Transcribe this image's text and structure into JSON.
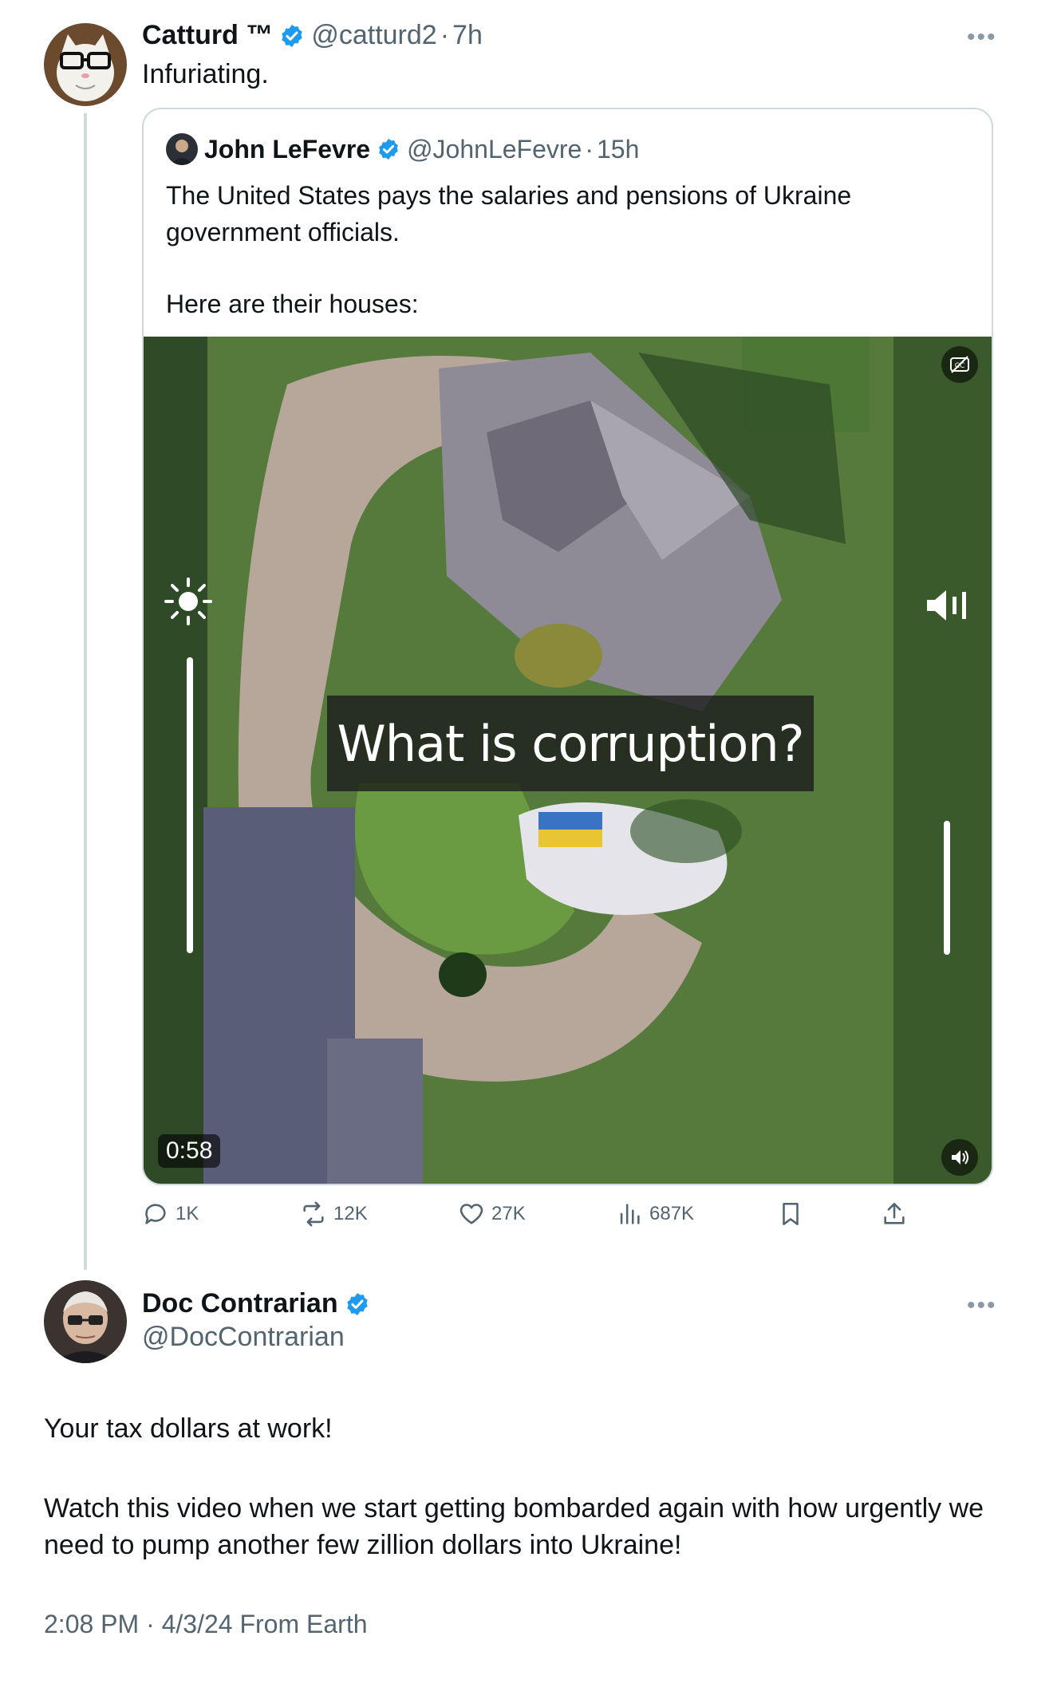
{
  "first_tweet": {
    "display_name": "Catturd ™",
    "handle": "@catturd2",
    "separator": "·",
    "time": "7h",
    "text": "Infuriating.",
    "avatar_icon": "cat-with-glasses-avatar"
  },
  "quoted_tweet": {
    "display_name": "John LeFevre",
    "handle": "@JohnLeFevre",
    "separator": "·",
    "time": "15h",
    "text_line1": "The United States pays the salaries and pensions of Ukraine government officials.",
    "text_line2": "Here are their houses:",
    "video": {
      "caption": "What is corruption?",
      "duration": "0:58",
      "cc_icon": "closed-captions-icon",
      "mute_icon": "speaker-icon",
      "brightness_level": 0.7,
      "volume_level": 0.3
    }
  },
  "actions": {
    "replies": "1K",
    "reposts": "12K",
    "likes": "27K",
    "views": "687K"
  },
  "reply_tweet": {
    "display_name": "Doc Contrarian",
    "handle": "@DocContrarian",
    "text_para1": "Your tax dollars at work!",
    "text_para2": "Watch this video when we start getting bombarded again with how urgently we need to pump another few zillion dollars into Ukraine!",
    "time": "2:08 PM",
    "separator": "·",
    "date": "4/3/24",
    "source": "From Earth",
    "timestamp_full": "2:08 PM · 4/3/24 From Earth"
  },
  "colors": {
    "verified_blue": "#1d9bf0",
    "secondary_text": "#536471",
    "border": "#cfd9de"
  }
}
